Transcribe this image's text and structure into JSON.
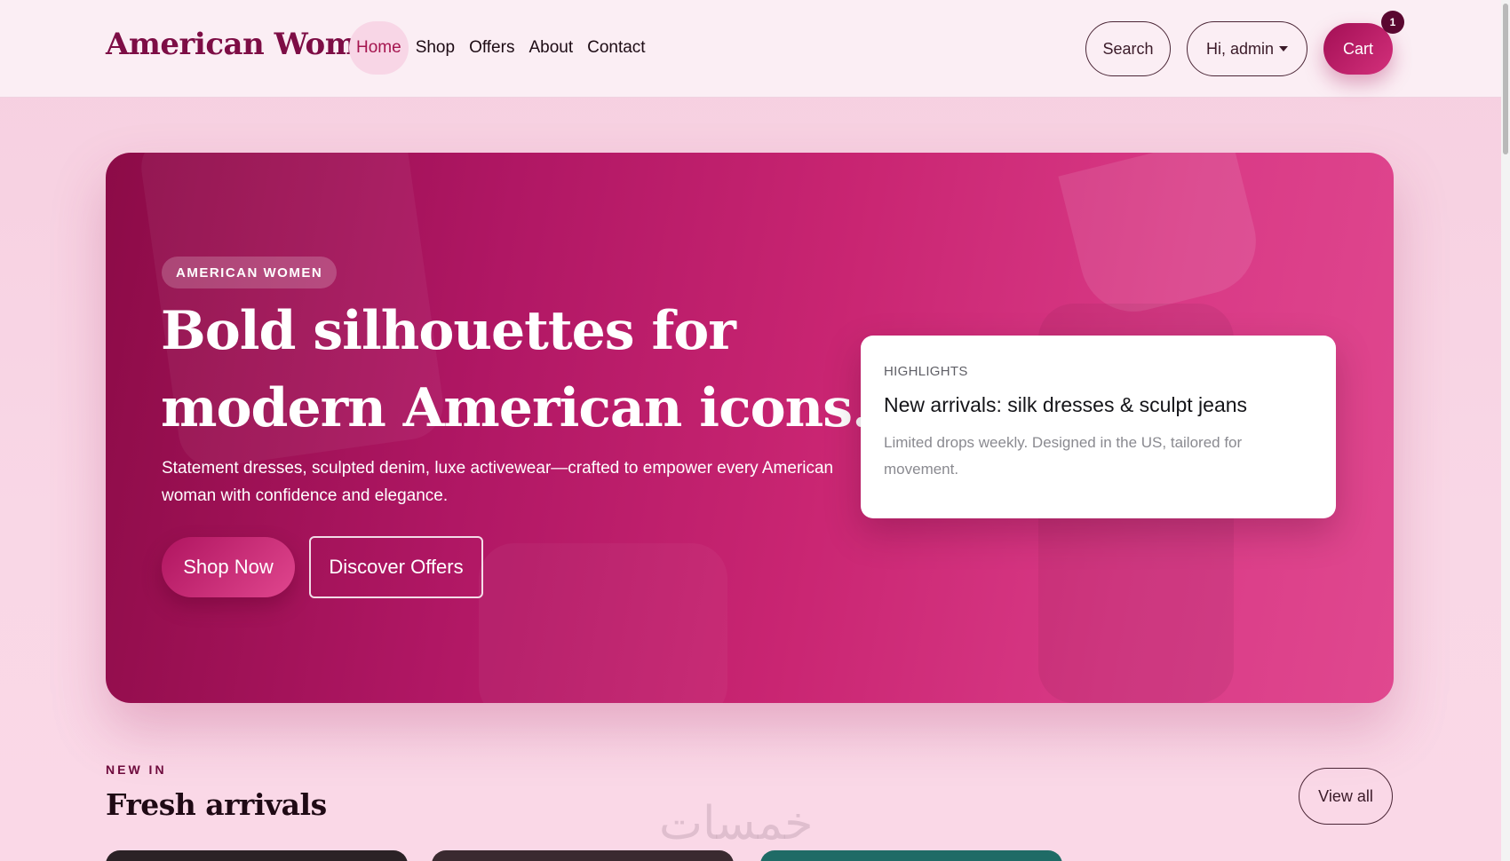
{
  "header": {
    "brand": "American Women",
    "nav": [
      {
        "label": "Home",
        "active": true
      },
      {
        "label": "Shop"
      },
      {
        "label": "Offers"
      },
      {
        "label": "About"
      },
      {
        "label": "Contact"
      }
    ],
    "search_label": "Search",
    "user_label": "Hi, admin",
    "cart_label": "Cart",
    "cart_count": "1"
  },
  "hero": {
    "eyebrow": "AMERICAN WOMEN",
    "title": "Bold silhouettes for modern American icons.",
    "subtitle": "Statement dresses, sculpted denim, luxe activewear—crafted to empower every American woman with confidence and elegance.",
    "primary_cta": "Shop Now",
    "secondary_cta": "Discover Offers",
    "highlight": {
      "label": "HIGHLIGHTS",
      "title": "New arrivals: silk dresses & sculpt jeans",
      "body": "Limited drops weekly. Designed in the US, tailored for movement."
    }
  },
  "section": {
    "eyebrow": "NEW IN",
    "title": "Fresh arrivals",
    "view_all": "View all"
  },
  "watermark": "خمسات",
  "colors": {
    "brand": "#7d0d45",
    "accent": "#c92572",
    "background": "#f9d5e4"
  }
}
